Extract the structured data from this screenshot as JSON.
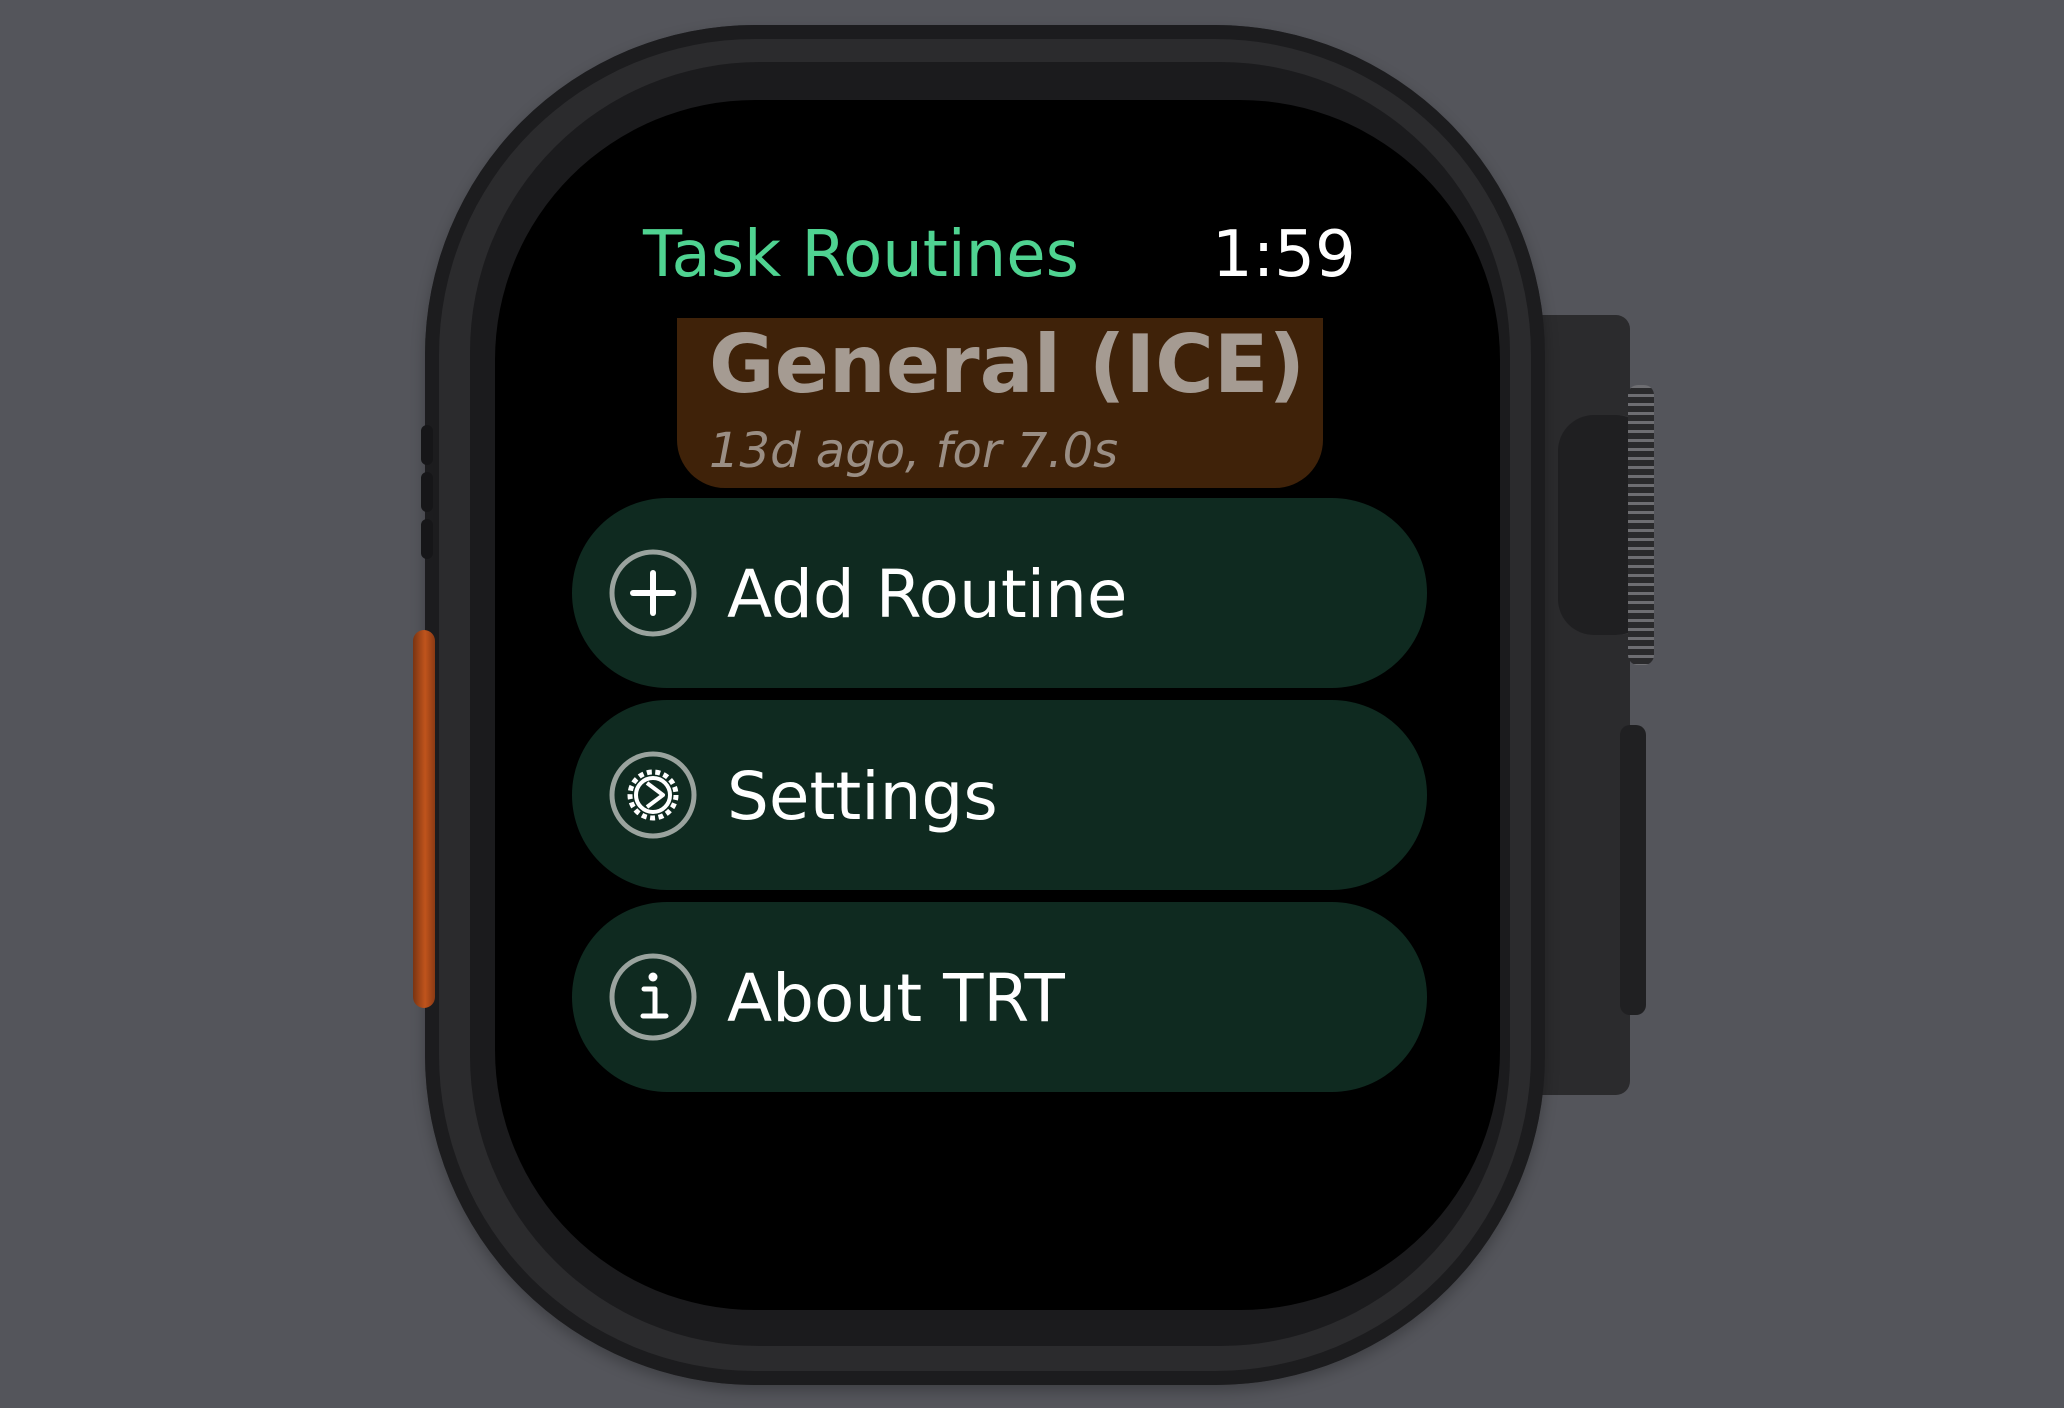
{
  "header": {
    "app_title": "Task Routines",
    "time": "1:59"
  },
  "routine": {
    "name": "General (ICE)",
    "meta": "13d ago, for 7.0s"
  },
  "menu": [
    {
      "label": "Add Routine",
      "icon": "plus-circle-icon"
    },
    {
      "label": "Settings",
      "icon": "gear-icon"
    },
    {
      "label": "About TRT",
      "icon": "info-circle-icon"
    }
  ],
  "colors": {
    "accent": "#4fd391",
    "button_bg": "#0f2a20",
    "routine_bg": "#3f2209",
    "action_button": "#c0541c"
  }
}
